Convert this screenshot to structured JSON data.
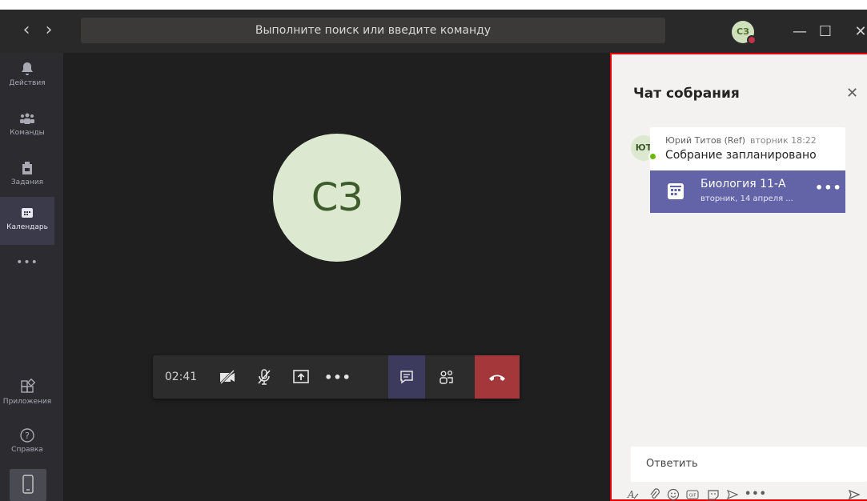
{
  "titlebar": {
    "search_placeholder": "Выполните поиск или введите команду",
    "avatar_initials": "СЗ",
    "back_glyph": "‹",
    "forward_glyph": "›",
    "minimize_glyph": "—",
    "maximize_glyph": "☐",
    "close_glyph": "✕"
  },
  "rail": {
    "items": [
      {
        "label": "Действия",
        "icon": "bell-icon"
      },
      {
        "label": "Команды",
        "icon": "teams-icon"
      },
      {
        "label": "Задания",
        "icon": "assignments-icon"
      },
      {
        "label": "Календарь",
        "icon": "calendar-icon"
      },
      {
        "label": "•••",
        "icon": "more-icon"
      }
    ],
    "apps_label": "Приложения",
    "help_label": "Справка"
  },
  "stage": {
    "avatar_initials": "СЗ",
    "call_time": "02:41"
  },
  "chat": {
    "title": "Чат собрания",
    "message": {
      "avatar_initials": "ЮТ",
      "author": "Юрий Титов (Ref)",
      "time": "вторник 18:22",
      "text": "Собрание запланировано"
    },
    "meeting": {
      "title": "Биология 11-А",
      "subtitle": "вторник, 14 апреля ...",
      "more": "•••"
    },
    "reply_placeholder": "Ответить"
  },
  "colors": {
    "accent": "#6264a7",
    "hangup": "#a4373a",
    "highlight_border": "#e60000",
    "presence_busy": "#c4314b",
    "presence_available": "#6bb700"
  }
}
